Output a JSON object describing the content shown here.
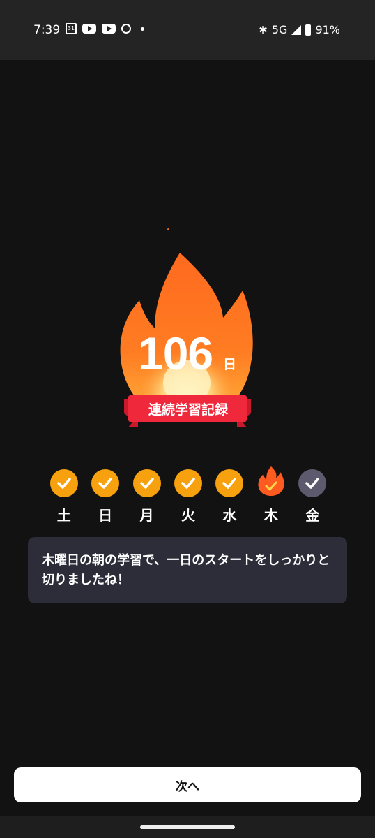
{
  "status_bar": {
    "time": "7:39",
    "calendar_day": "31",
    "network": "5G",
    "battery": "91%",
    "icons": [
      "calendar-icon",
      "youtube-icon",
      "youtube-icon",
      "alarm-icon",
      "dot-icon",
      "bluetooth-icon",
      "signal-icon",
      "battery-icon"
    ]
  },
  "streak": {
    "count": "106",
    "unit": "日",
    "ribbon_label": "連続学習記録"
  },
  "week": [
    {
      "label": "土",
      "state": "done"
    },
    {
      "label": "日",
      "state": "done"
    },
    {
      "label": "月",
      "state": "done"
    },
    {
      "label": "火",
      "state": "done"
    },
    {
      "label": "水",
      "state": "done"
    },
    {
      "label": "木",
      "state": "today"
    },
    {
      "label": "金",
      "state": "pending"
    }
  ],
  "message": "木曜日の朝の学習で、一日のスタートをしっかりと切りましたね！",
  "next_button": "次へ",
  "colors": {
    "background": "#121212",
    "done": "#f7a10e",
    "today_flame": "#ff5a1f",
    "pending": "#5c5a6c",
    "ribbon": "#f0283c",
    "card": "#2d2d3a"
  }
}
